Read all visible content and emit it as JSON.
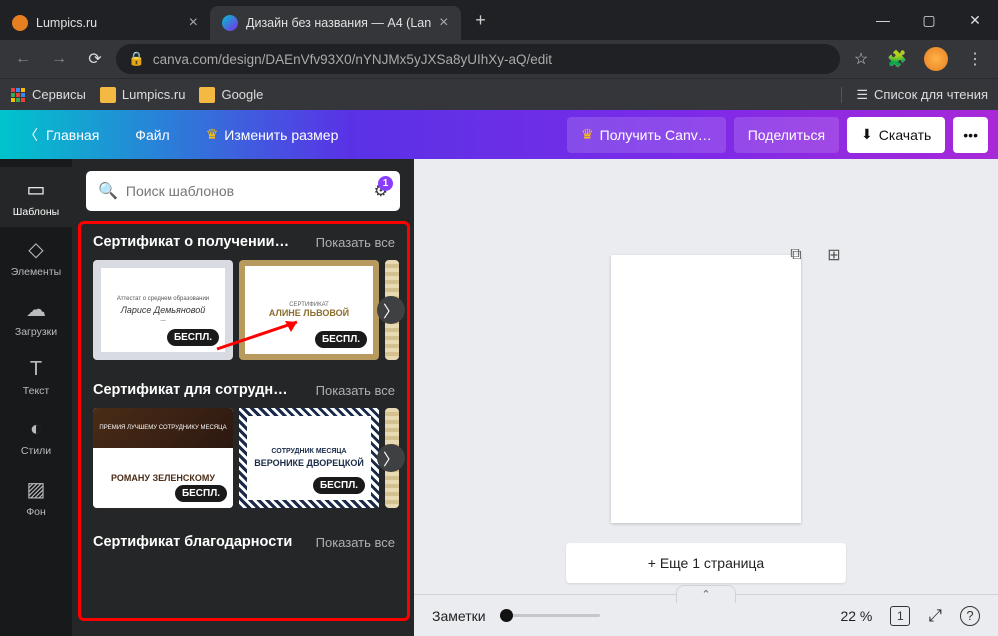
{
  "titlebar": {
    "tabs": [
      {
        "title": "Lumpics.ru",
        "favicon": "#e67e22"
      },
      {
        "title": "Дизайн без названия — A4 (Lan"
      }
    ]
  },
  "addressbar": {
    "url": "canva.com/design/DAEnVfv93X0/nYNJMx5yJXSa8yUIhXy-aQ/edit"
  },
  "bookmarks": {
    "items": [
      "Сервисы",
      "Lumpics.ru",
      "Google"
    ],
    "reading_list": "Список для чтения"
  },
  "canva_top": {
    "home": "Главная",
    "file": "Файл",
    "resize": "Изменить размер",
    "get_pro": "Получить Canv…",
    "share": "Поделиться",
    "download": "Скачать"
  },
  "rail": {
    "templates": "Шаблоны",
    "elements": "Элементы",
    "uploads": "Загрузки",
    "text": "Текст",
    "styles": "Стили",
    "background": "Фон"
  },
  "search": {
    "placeholder": "Поиск шаблонов",
    "badge": "1"
  },
  "sections": [
    {
      "title": "Сертификат о получении ди…",
      "show_all": "Показать все",
      "cards": [
        {
          "line1": "Аттестат о среднем образовании",
          "name": "Ларисе Демьяновой",
          "badge": "БЕСПЛ."
        },
        {
          "line1": "СЕРТИФИКАТ",
          "name": "АЛИНЕ ЛЬВОВОЙ",
          "badge": "БЕСПЛ."
        }
      ]
    },
    {
      "title": "Сертификат для сотрудников",
      "show_all": "Показать все",
      "cards": [
        {
          "top": "ПРЕМИЯ ЛУЧШЕМУ СОТРУДНИКУ МЕСЯЦА",
          "name": "РОМАНУ ЗЕЛЕНСКОМУ",
          "badge": "БЕСПЛ."
        },
        {
          "top": "СОТРУДНИК МЕСЯЦА",
          "name": "ВЕРОНИКЕ ДВОРЕЦКОЙ",
          "badge": "БЕСПЛ."
        }
      ]
    },
    {
      "title": "Сертификат благодарности",
      "show_all": "Показать все"
    }
  ],
  "canvas": {
    "add_page": "+ Еще 1 страница",
    "notes": "Заметки",
    "zoom": "22 %",
    "page_indicator": "1"
  }
}
